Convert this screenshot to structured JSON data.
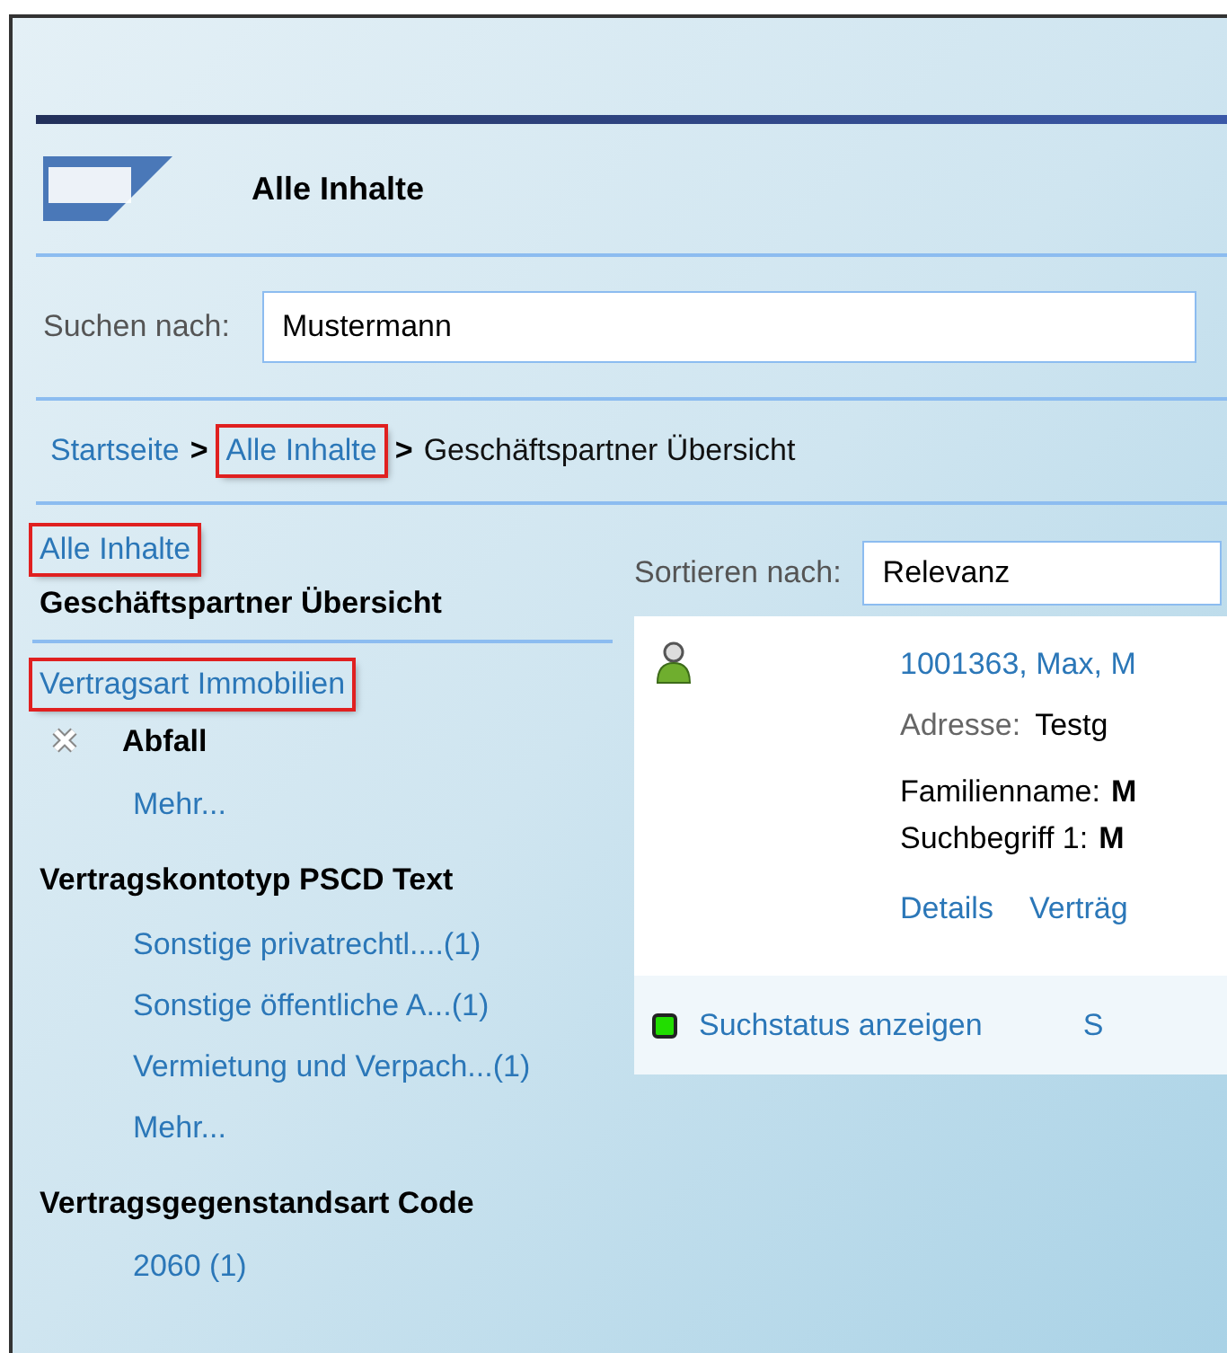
{
  "header": {
    "title": "Alle Inhalte"
  },
  "search": {
    "label": "Suchen nach:",
    "value": "Mustermann"
  },
  "breadcrumb": [
    {
      "label": "Startseite",
      "kind": "link",
      "highlighted": false
    },
    {
      "separator": ">",
      "label": "Alle Inhalte",
      "kind": "link",
      "highlighted": true
    },
    {
      "separator": ">",
      "label": "Geschäftspartner Übersicht",
      "kind": "current",
      "highlighted": false
    }
  ],
  "sidebar": {
    "top_link": {
      "label": "Alle Inhalte",
      "highlighted": true
    },
    "heading": "Geschäftspartner Übersicht",
    "groups": [
      {
        "title": "Vertragsart Immobilien",
        "kind": "link",
        "highlighted": true,
        "items": [
          {
            "label": "Abfall",
            "kind": "selected"
          },
          {
            "label": "Mehr...",
            "kind": "link"
          }
        ]
      },
      {
        "title": "Vertragskontotyp PSCD Text",
        "kind": "heading",
        "highlighted": false,
        "items": [
          {
            "label": "Sonstige privatrechtl....(1)",
            "kind": "link"
          },
          {
            "label": "Sonstige öffentliche A...(1)",
            "kind": "link"
          },
          {
            "label": "Vermietung und Verpach...(1)",
            "kind": "link"
          },
          {
            "label": "Mehr...",
            "kind": "link"
          }
        ]
      },
      {
        "title": "Vertragsgegenstandsart Code",
        "kind": "heading",
        "highlighted": false,
        "items": [
          {
            "label": "2060 (1)",
            "kind": "link"
          }
        ]
      }
    ]
  },
  "sort": {
    "label": "Sortieren nach:",
    "value": "Relevanz"
  },
  "result": {
    "title": "1001363, Max, M",
    "address_label": "Adresse:",
    "address": "Testg",
    "fields": [
      {
        "label": "Familienname:",
        "value": "M"
      },
      {
        "label": "Suchbegriff 1:",
        "value": "M"
      }
    ],
    "links": [
      "Details",
      "Verträg"
    ]
  },
  "footer": {
    "status": {
      "label": "Suchstatus anzeigen",
      "color": "#22dd00"
    },
    "column_2": "S"
  }
}
